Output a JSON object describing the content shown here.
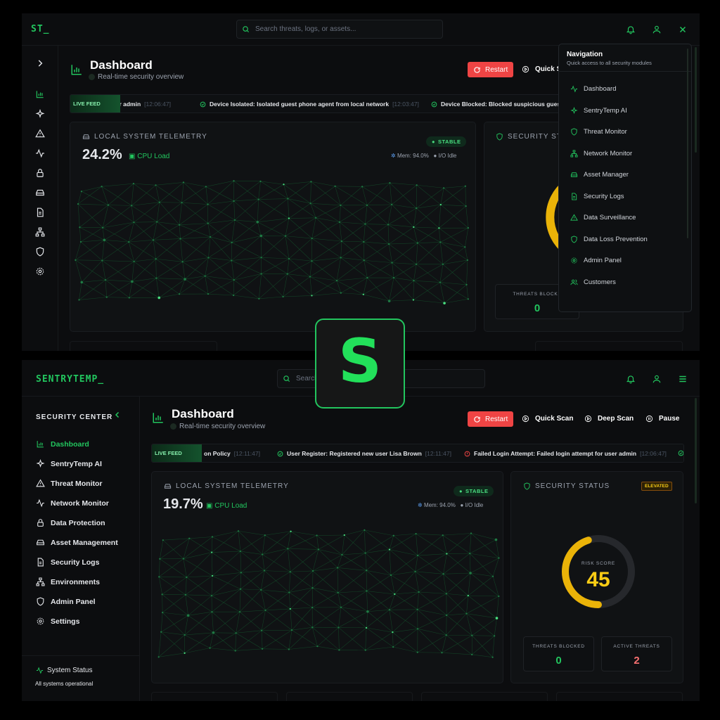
{
  "colors": {
    "accent": "#22c55e",
    "danger": "#ef4444",
    "warning": "#eab308",
    "background": "#0c0d0f"
  },
  "logo": {
    "letter": "S"
  },
  "top": {
    "brand": "ST_",
    "search_placeholder": "Search threats, logs, or assets...",
    "dashboard": {
      "title": "Dashboard",
      "subtitle": "Real-time security overview"
    },
    "actions": {
      "restart": "Restart",
      "quick_scan": "Quick S"
    },
    "feed": {
      "badge": "LIVE FEED",
      "items": [
        {
          "text": "ser admin",
          "time": "[12:06:47]"
        },
        {
          "text": "Device Isolated: Isolated guest phone agent from local network",
          "time": "[12:03:47]"
        },
        {
          "text": "Device Blocked: Blocked suspicious guest W",
          "time": ""
        }
      ]
    },
    "telemetry": {
      "title": "LOCAL SYSTEM TELEMETRY",
      "value": "24.2%",
      "metric": "CPU Load",
      "status": "STABLE",
      "mem": "Mem: 94.0%",
      "io": "I/O Idle"
    },
    "security": {
      "title": "SECURITY STAT",
      "threats_blocked_label": "THREATS BLOCKE",
      "threats_blocked": "0"
    },
    "navigation": {
      "title": "Navigation",
      "subtitle": "Quick access to all security modules",
      "items": [
        {
          "label": "Dashboard",
          "icon": "chart-line-icon"
        },
        {
          "label": "SentryTemp AI",
          "icon": "sparkles-icon"
        },
        {
          "label": "Threat Monitor",
          "icon": "shield-icon"
        },
        {
          "label": "Network Monitor",
          "icon": "network-icon"
        },
        {
          "label": "Asset Manager",
          "icon": "hard-drive-icon"
        },
        {
          "label": "Security Logs",
          "icon": "file-icon"
        },
        {
          "label": "Data Surveillance",
          "icon": "alert-triangle-icon"
        },
        {
          "label": "Data Loss Prevention",
          "icon": "shield-icon"
        },
        {
          "label": "Admin Panel",
          "icon": "gear-icon"
        },
        {
          "label": "Customers",
          "icon": "users-icon"
        }
      ]
    }
  },
  "bottom": {
    "brand": "SENTRYTEMP_",
    "search_placeholder": "Search threats, logs, or assets...",
    "security_center": "SECURITY CENTER",
    "sidebar": [
      {
        "label": "Dashboard",
        "icon": "bar-chart-icon",
        "active": true
      },
      {
        "label": "SentryTemp AI",
        "icon": "sparkles-icon"
      },
      {
        "label": "Threat Monitor",
        "icon": "alert-triangle-icon"
      },
      {
        "label": "Network Monitor",
        "icon": "activity-icon"
      },
      {
        "label": "Data Protection",
        "icon": "lock-icon"
      },
      {
        "label": "Asset Management",
        "icon": "hard-drive-icon"
      },
      {
        "label": "Security Logs",
        "icon": "file-icon"
      },
      {
        "label": "Environments",
        "icon": "network-icon"
      },
      {
        "label": "Admin Panel",
        "icon": "shield-icon"
      },
      {
        "label": "Settings",
        "icon": "gear-icon"
      }
    ],
    "system_status": {
      "title": "System Status",
      "text": "All systems operational"
    },
    "dashboard": {
      "title": "Dashboard",
      "subtitle": "Real-time security overview"
    },
    "actions": {
      "restart": "Restart",
      "quick_scan": "Quick Scan",
      "deep_scan": "Deep Scan",
      "pause": "Pause"
    },
    "feed": {
      "badge": "LIVE FEED",
      "items": [
        {
          "text": "on Policy",
          "time": "[12:11:47]"
        },
        {
          "text": "User Register: Registered new user Lisa Brown",
          "time": "[12:11:47]"
        },
        {
          "text": "Failed Login Attempt: Failed login attempt for user admin",
          "time": "[12:06:47]"
        }
      ]
    },
    "telemetry": {
      "title": "LOCAL SYSTEM TELEMETRY",
      "value": "19.7%",
      "metric": "CPU Load",
      "status": "STABLE",
      "mem": "Mem: 94.0%",
      "io": "I/O Idle"
    },
    "security": {
      "title": "SECURITY STATUS",
      "level": "ELEVATED",
      "risk_label": "RISK SCORE",
      "risk_score": "45",
      "risk_fraction": 0.45,
      "threats_blocked_label": "THREATS BLOCKED",
      "threats_blocked": "0",
      "active_threats_label": "ACTIVE THREATS",
      "active_threats": "2"
    }
  }
}
